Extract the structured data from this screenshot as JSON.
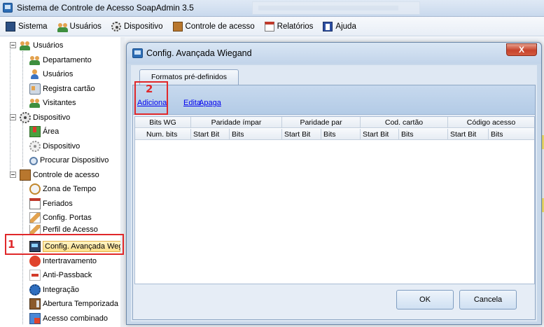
{
  "app": {
    "title": "Sistema de Controle de Acesso SoapAdmin 3.5"
  },
  "menu": [
    {
      "label": "Sistema",
      "icon": "computer-icon"
    },
    {
      "label": "Usuários",
      "icon": "user-icon"
    },
    {
      "label": "Dispositivo",
      "icon": "gear-icon"
    },
    {
      "label": "Controle de acesso",
      "icon": "door-icon"
    },
    {
      "label": "Relatórios",
      "icon": "report-icon"
    },
    {
      "label": "Ajuda",
      "icon": "help-book-icon"
    }
  ],
  "tree": {
    "usuarios": {
      "label": "Usuários",
      "children": [
        "Departamento",
        "Usuários",
        "Registra cartão",
        "Visitantes"
      ]
    },
    "dispositivo": {
      "label": "Dispositivo",
      "children": [
        "Área",
        "Dispositivo",
        "Procurar Dispositivo"
      ]
    },
    "controle": {
      "label": "Controle de acesso",
      "children": [
        "Zona de Tempo",
        "Feriados",
        "Config. Portas",
        "Perfil de Acesso",
        "Config. Avançada Wega",
        "Intertravamento",
        "Anti-Passback",
        "Integração",
        "Abertura Temporizada",
        "Acesso combinado"
      ]
    }
  },
  "dialog": {
    "title": "Config. Avançada Wiegand",
    "close_symbol": "X",
    "tab_label": "Formatos pré-definidos",
    "toolbar": {
      "add": "Adiciona",
      "edit": "Edita",
      "delete": "Apaga"
    },
    "grid": {
      "group_headers": [
        "Bits WG",
        "Paridade ímpar",
        "Paridade par",
        "Cod. cartão",
        "Código acesso"
      ],
      "sub_headers": [
        "Num. bits",
        "Start Bit",
        "Bits",
        "Start Bit",
        "Bits",
        "Start Bit",
        "Bits",
        "Start Bit",
        "Bits"
      ]
    },
    "buttons": {
      "ok": "OK",
      "cancel": "Cancela"
    }
  },
  "callouts": {
    "one": "1",
    "two": "2"
  },
  "colors": {
    "callout": "#e0282a",
    "link": "#0000ee",
    "selection": "#ffe08a"
  }
}
